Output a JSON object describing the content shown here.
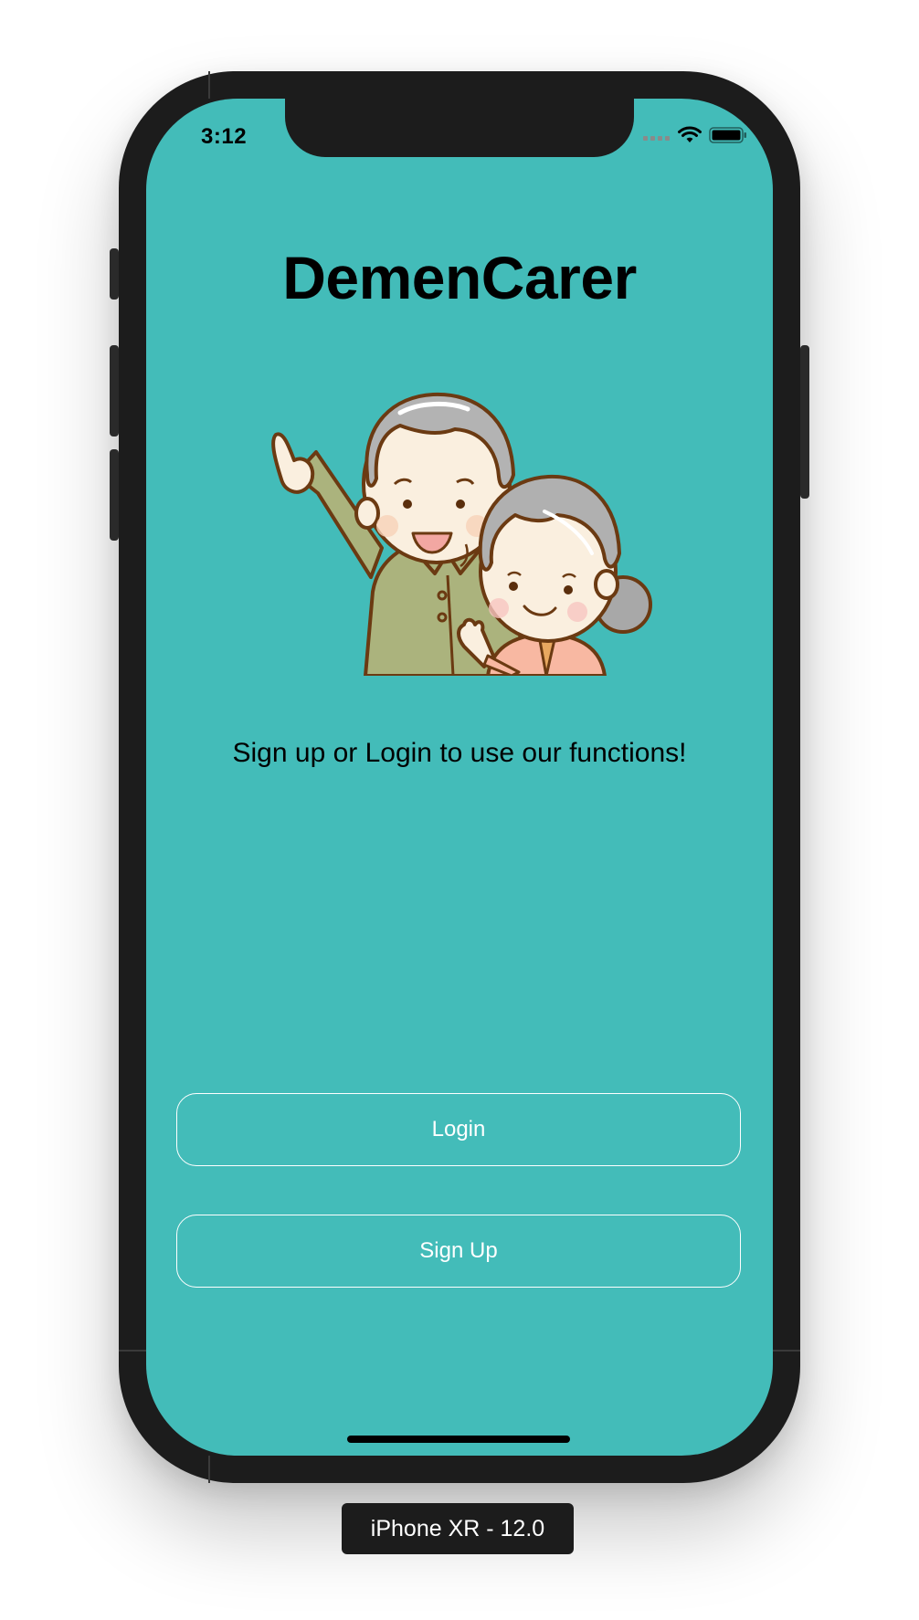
{
  "status_bar": {
    "time": "3:12",
    "icons": [
      "signal-dots-icon",
      "wifi-icon",
      "battery-icon"
    ]
  },
  "app": {
    "title": "DemenCarer",
    "illustration": "elderly-couple-illustration",
    "tagline": "Sign up or Login to use our functions!"
  },
  "buttons": {
    "login_label": "Login",
    "signup_label": "Sign Up"
  },
  "simulator": {
    "device_label": "iPhone XR - 12.0"
  },
  "colors": {
    "screen_background": "#43bcb9",
    "button_border": "#ffffff",
    "button_text": "#ffffff",
    "title_text": "#000000"
  }
}
